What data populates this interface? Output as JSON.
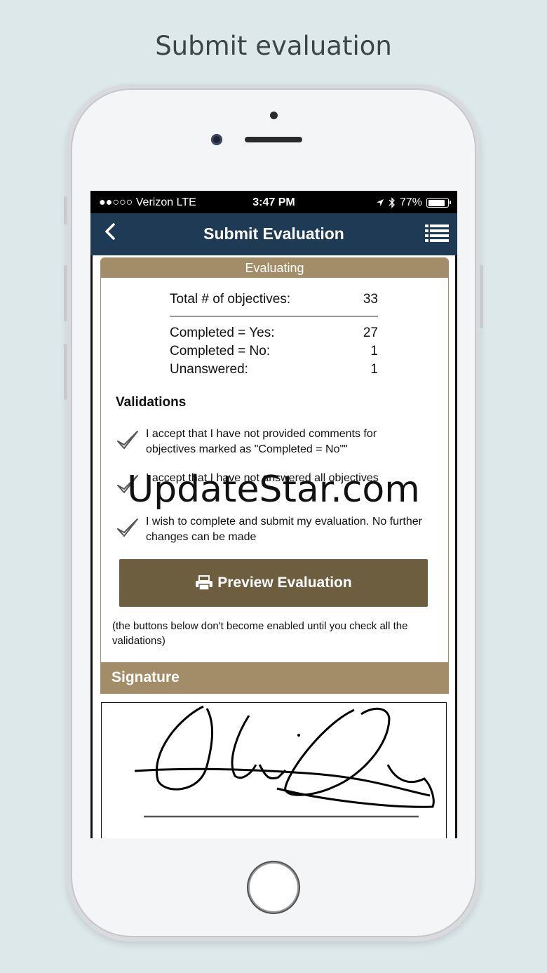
{
  "caption": "Submit evaluation",
  "status_bar": {
    "carrier": "●●○○○ Verizon   LTE",
    "time": "3:47 PM",
    "battery": "77%",
    "battery_level": 0.77
  },
  "nav": {
    "title": "Submit Evaluation",
    "back_icon": "chevron-left-icon",
    "menu_icon": "list-icon"
  },
  "evaluating": {
    "header": "Evaluating",
    "stats": [
      {
        "label": "Total # of objectives:",
        "value": "33"
      },
      {
        "label": "Completed = Yes:",
        "value": "27"
      },
      {
        "label": "Completed = No:",
        "value": "1"
      },
      {
        "label": "Unanswered:",
        "value": "1"
      }
    ]
  },
  "validations": {
    "title": "Validations",
    "items": [
      {
        "text": "I accept that I have not provided comments for objectives marked as \"Completed = No\"\"",
        "checked": true
      },
      {
        "text": "I accept that I have not answered all objectives",
        "checked": true
      },
      {
        "text": "I wish to complete and submit my evaluation. No further changes can be made",
        "checked": true
      }
    ]
  },
  "preview_button": {
    "label": "Preview Evaluation",
    "icon": "printer-icon",
    "color": "#6e5e40"
  },
  "note": "(the buttons below don't become enabled until you check all the validations)",
  "signature": {
    "header": "Signature"
  },
  "watermark": "UpdateStar.com",
  "colors": {
    "accent": "#a38d68",
    "navbar": "#1e3a55"
  }
}
